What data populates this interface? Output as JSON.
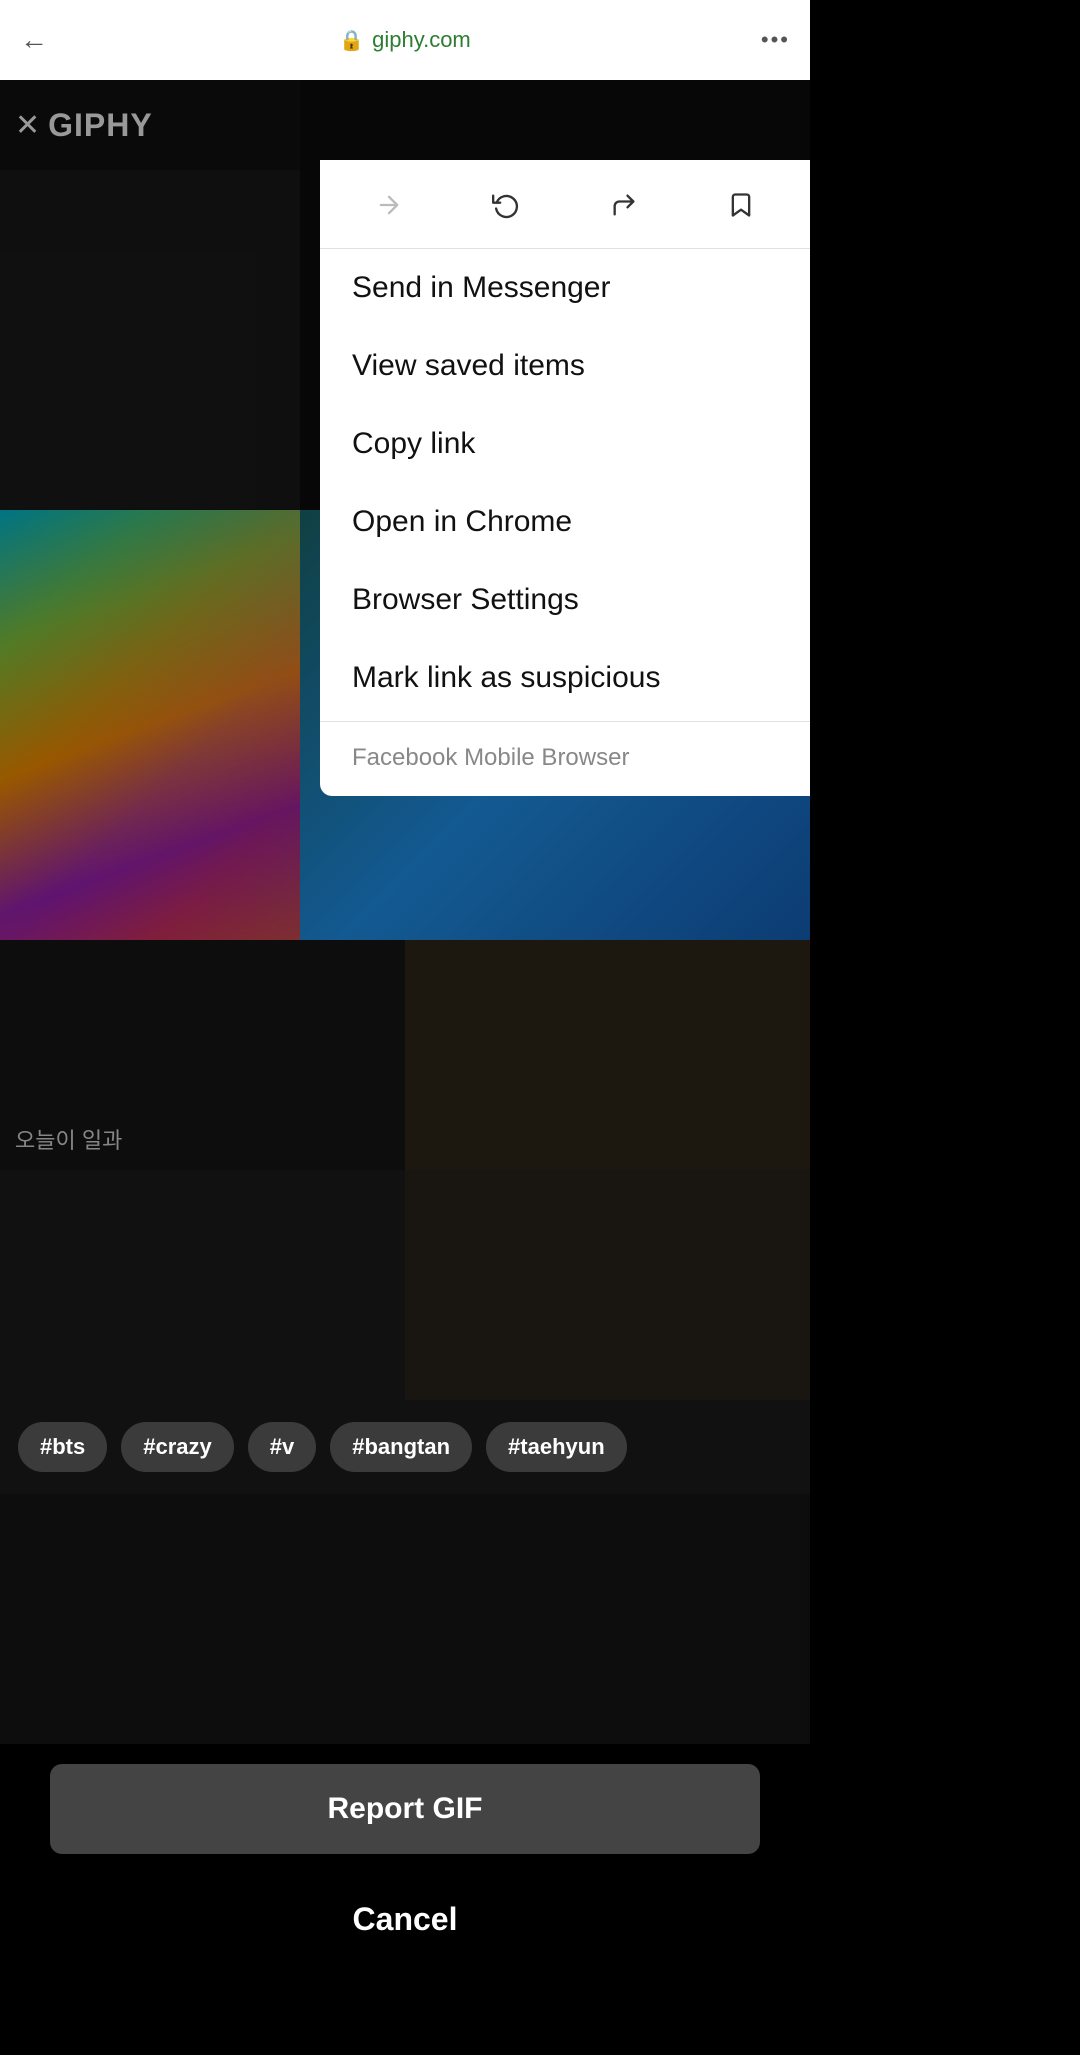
{
  "browser": {
    "url": "giphy.com",
    "back_label": "←",
    "more_label": "•••",
    "lock_symbol": "🔒"
  },
  "toolbar": {
    "forward_title": "forward",
    "reload_title": "reload",
    "share_title": "share",
    "bookmark_title": "bookmark"
  },
  "menu": {
    "items": [
      {
        "id": "send-messenger",
        "label": "Send in Messenger"
      },
      {
        "id": "view-saved",
        "label": "View saved items"
      },
      {
        "id": "copy-link",
        "label": "Copy link"
      },
      {
        "id": "open-chrome",
        "label": "Open in Chrome"
      },
      {
        "id": "browser-settings",
        "label": "Browser Settings"
      },
      {
        "id": "mark-suspicious",
        "label": "Mark link as suspicious"
      }
    ],
    "footer_label": "Facebook Mobile Browser"
  },
  "giphy": {
    "logo": "GIPHY",
    "close_symbol": "✕"
  },
  "tags": [
    {
      "id": "bts",
      "label": "#bts"
    },
    {
      "id": "crazy",
      "label": "#crazy"
    },
    {
      "id": "v",
      "label": "#v"
    },
    {
      "id": "bangtan",
      "label": "#bangtan"
    },
    {
      "id": "taehyun",
      "label": "#taehyun"
    }
  ],
  "content_cells": [
    {
      "text": "오늘이 일과"
    },
    {
      "text": ""
    }
  ],
  "actions": {
    "report_gif": "Report GIF",
    "cancel": "Cancel"
  }
}
